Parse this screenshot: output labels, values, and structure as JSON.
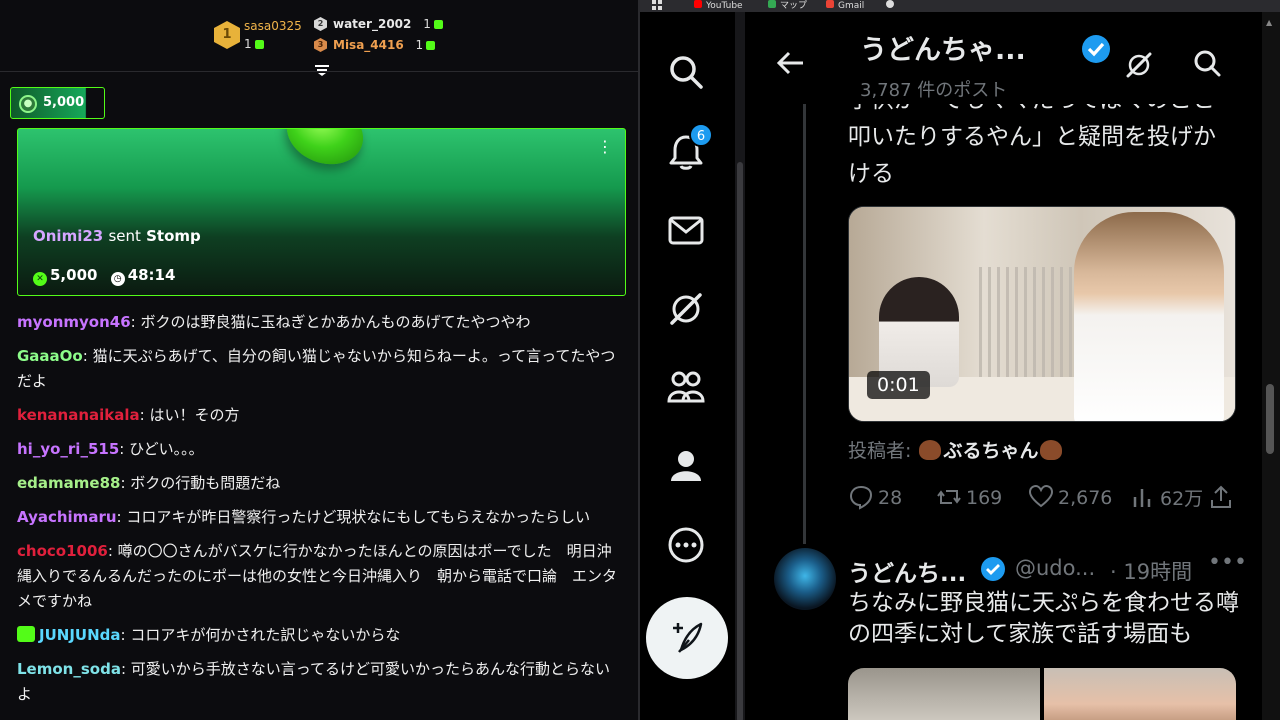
{
  "chat": {
    "leaderboard": {
      "first": {
        "rank": "1",
        "name": "sasa0325",
        "count": "1"
      },
      "second": {
        "rank": "2",
        "name": "water_2002",
        "count": "1"
      },
      "third": {
        "rank": "3",
        "name": "Misa_4416",
        "count": "1"
      }
    },
    "pinned_pill_value": "5,000",
    "gift": {
      "user": "Onimi23",
      "sent_word": "sent",
      "item": "Stomp",
      "amount": "5,000",
      "timer": "48:14"
    },
    "messages": [
      {
        "user": "myonmyon46",
        "color": "#c774ff",
        "text": "ボクのは野良猫に玉ねぎとかあかんものあげてたやつやわ"
      },
      {
        "user": "GaaaOo",
        "color": "#8dfc8a",
        "text": "猫に天ぷらあげて、自分の飼い猫じゃないから知らねーよ。って言ってたやつだよ"
      },
      {
        "user": "kenananaikala",
        "color": "#e0203c",
        "text": "はい！その方"
      },
      {
        "user": "hi_yo_ri_515",
        "color": "#c774ff",
        "text": "ひどい。。。"
      },
      {
        "user": "edamame88",
        "color": "#a6f08a",
        "text": "ボクの行動も問題だね"
      },
      {
        "user": "Ayachimaru",
        "color": "#c774ff",
        "text": "コロアキが昨日警察行ったけど現状なにもしてもらえなかったらしい"
      },
      {
        "user": "choco1006",
        "color": "#e0203c",
        "text": "噂の〇〇さんがバスケに行かなかったほんとの原因はポーでした　明日沖縄入りでるんるんだったのにポーは他の女性と今日沖縄入り　朝から電話で口論　エンタメですかね"
      },
      {
        "user": "JUNJUNda",
        "color": "#5ad8ff",
        "text": "コロアキが何かされた訳じゃないからな",
        "gift_icon": true
      },
      {
        "user": "Lemon_soda",
        "color": "#7fe3e8",
        "text": "可愛いから手放さない言ってるけど可愛いかったらあんな行動とらないよ"
      }
    ]
  },
  "browser": {
    "bookmarks": [
      {
        "label": "YouTube",
        "color": "#ff0000"
      },
      {
        "label": "マップ",
        "color": "#34a853"
      },
      {
        "label": "Gmail",
        "color": "#ea4335"
      }
    ]
  },
  "twitter": {
    "notifications_count": "6",
    "profile_name": "うどんちゃ...",
    "post_count": "3,787 件のポスト",
    "tweet1": {
      "text_partial_top": "子供が「でもママだってぼくのこと",
      "text_rest": "叩いたりするやん」と疑問を投げかける",
      "video_time": "0:01",
      "posted_by_label": "投稿者:",
      "posted_by_name": "ぶるちゃん",
      "replies": "28",
      "reposts": "169",
      "likes": "2,676",
      "views": "62万"
    },
    "tweet2": {
      "name": "うどんち...",
      "handle": "@udo...",
      "time": "· 19時間",
      "text": "ちなみに野良猫に天ぷらを食わせる噂の四季に対して家族で話す場面も"
    }
  }
}
